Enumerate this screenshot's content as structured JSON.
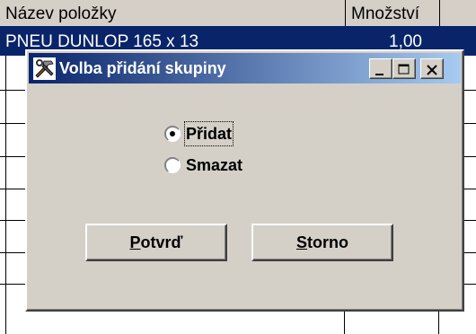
{
  "table": {
    "headers": [
      "Název položky",
      "Množství"
    ],
    "selected_row": {
      "name": "PNEU DUNLOP 165 x 13",
      "qty": "1,00"
    }
  },
  "dialog": {
    "title": "Volba přidání skupiny",
    "icon": "hammer-wrench-icon",
    "options": [
      {
        "label": "Přidat",
        "selected": true
      },
      {
        "label": "Smazat",
        "selected": false
      }
    ],
    "buttons": {
      "confirm_accel": "P",
      "confirm_rest": "otvrď",
      "cancel_accel": "S",
      "cancel_rest": "torno"
    }
  },
  "colors": {
    "titlebar_start": "#0a246a",
    "titlebar_end": "#a6caf0",
    "face": "#d4d0c8",
    "selection": "#0a246a"
  }
}
